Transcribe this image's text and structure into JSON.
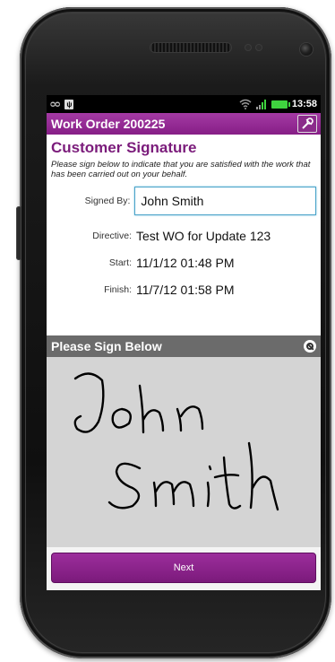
{
  "status_bar": {
    "time": "13:58",
    "icons": [
      "voicemail-icon",
      "usb-debug-icon",
      "wifi-icon",
      "signal-icon",
      "battery-icon"
    ]
  },
  "title_bar": {
    "title": "Work Order 200225",
    "menu_icon": "tools-icon"
  },
  "signature_form": {
    "section_title": "Customer Signature",
    "instructions": "Please sign below to indicate that you are satisfied with the work that has been carried out on your behalf.",
    "signed_by_label": "Signed By:",
    "signed_by_value": "John Smith",
    "directive_label": "Directive:",
    "directive_value": "Test WO for Update 123",
    "start_label": "Start:",
    "start_value": "11/1/12 01:48 PM",
    "finish_label": "Finish:",
    "finish_value": "11/7/12 01:58 PM"
  },
  "signature_pad": {
    "header": "Please Sign Below",
    "clear_icon": "clear-icon",
    "signature_text": "John Smith"
  },
  "footer": {
    "next_label": "Next"
  },
  "colors": {
    "title_bar": "#8e248e",
    "section_title": "#7b1c7b",
    "sign_header": "#6b6b6b",
    "signature_pad": "#d4d4d4",
    "next_button": "#8a238a"
  }
}
